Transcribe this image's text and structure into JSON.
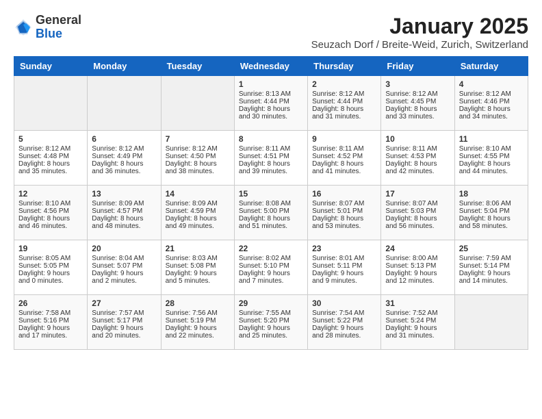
{
  "header": {
    "logo_general": "General",
    "logo_blue": "Blue",
    "title": "January 2025",
    "subtitle": "Seuzach Dorf / Breite-Weid, Zurich, Switzerland"
  },
  "weekdays": [
    "Sunday",
    "Monday",
    "Tuesday",
    "Wednesday",
    "Thursday",
    "Friday",
    "Saturday"
  ],
  "weeks": [
    {
      "days": [
        {
          "num": "",
          "content": ""
        },
        {
          "num": "",
          "content": ""
        },
        {
          "num": "",
          "content": ""
        },
        {
          "num": "1",
          "content": "Sunrise: 8:13 AM\nSunset: 4:44 PM\nDaylight: 8 hours\nand 30 minutes."
        },
        {
          "num": "2",
          "content": "Sunrise: 8:12 AM\nSunset: 4:44 PM\nDaylight: 8 hours\nand 31 minutes."
        },
        {
          "num": "3",
          "content": "Sunrise: 8:12 AM\nSunset: 4:45 PM\nDaylight: 8 hours\nand 33 minutes."
        },
        {
          "num": "4",
          "content": "Sunrise: 8:12 AM\nSunset: 4:46 PM\nDaylight: 8 hours\nand 34 minutes."
        }
      ]
    },
    {
      "days": [
        {
          "num": "5",
          "content": "Sunrise: 8:12 AM\nSunset: 4:48 PM\nDaylight: 8 hours\nand 35 minutes."
        },
        {
          "num": "6",
          "content": "Sunrise: 8:12 AM\nSunset: 4:49 PM\nDaylight: 8 hours\nand 36 minutes."
        },
        {
          "num": "7",
          "content": "Sunrise: 8:12 AM\nSunset: 4:50 PM\nDaylight: 8 hours\nand 38 minutes."
        },
        {
          "num": "8",
          "content": "Sunrise: 8:11 AM\nSunset: 4:51 PM\nDaylight: 8 hours\nand 39 minutes."
        },
        {
          "num": "9",
          "content": "Sunrise: 8:11 AM\nSunset: 4:52 PM\nDaylight: 8 hours\nand 41 minutes."
        },
        {
          "num": "10",
          "content": "Sunrise: 8:11 AM\nSunset: 4:53 PM\nDaylight: 8 hours\nand 42 minutes."
        },
        {
          "num": "11",
          "content": "Sunrise: 8:10 AM\nSunset: 4:55 PM\nDaylight: 8 hours\nand 44 minutes."
        }
      ]
    },
    {
      "days": [
        {
          "num": "12",
          "content": "Sunrise: 8:10 AM\nSunset: 4:56 PM\nDaylight: 8 hours\nand 46 minutes."
        },
        {
          "num": "13",
          "content": "Sunrise: 8:09 AM\nSunset: 4:57 PM\nDaylight: 8 hours\nand 48 minutes."
        },
        {
          "num": "14",
          "content": "Sunrise: 8:09 AM\nSunset: 4:59 PM\nDaylight: 8 hours\nand 49 minutes."
        },
        {
          "num": "15",
          "content": "Sunrise: 8:08 AM\nSunset: 5:00 PM\nDaylight: 8 hours\nand 51 minutes."
        },
        {
          "num": "16",
          "content": "Sunrise: 8:07 AM\nSunset: 5:01 PM\nDaylight: 8 hours\nand 53 minutes."
        },
        {
          "num": "17",
          "content": "Sunrise: 8:07 AM\nSunset: 5:03 PM\nDaylight: 8 hours\nand 56 minutes."
        },
        {
          "num": "18",
          "content": "Sunrise: 8:06 AM\nSunset: 5:04 PM\nDaylight: 8 hours\nand 58 minutes."
        }
      ]
    },
    {
      "days": [
        {
          "num": "19",
          "content": "Sunrise: 8:05 AM\nSunset: 5:05 PM\nDaylight: 9 hours\nand 0 minutes."
        },
        {
          "num": "20",
          "content": "Sunrise: 8:04 AM\nSunset: 5:07 PM\nDaylight: 9 hours\nand 2 minutes."
        },
        {
          "num": "21",
          "content": "Sunrise: 8:03 AM\nSunset: 5:08 PM\nDaylight: 9 hours\nand 5 minutes."
        },
        {
          "num": "22",
          "content": "Sunrise: 8:02 AM\nSunset: 5:10 PM\nDaylight: 9 hours\nand 7 minutes."
        },
        {
          "num": "23",
          "content": "Sunrise: 8:01 AM\nSunset: 5:11 PM\nDaylight: 9 hours\nand 9 minutes."
        },
        {
          "num": "24",
          "content": "Sunrise: 8:00 AM\nSunset: 5:13 PM\nDaylight: 9 hours\nand 12 minutes."
        },
        {
          "num": "25",
          "content": "Sunrise: 7:59 AM\nSunset: 5:14 PM\nDaylight: 9 hours\nand 14 minutes."
        }
      ]
    },
    {
      "days": [
        {
          "num": "26",
          "content": "Sunrise: 7:58 AM\nSunset: 5:16 PM\nDaylight: 9 hours\nand 17 minutes."
        },
        {
          "num": "27",
          "content": "Sunrise: 7:57 AM\nSunset: 5:17 PM\nDaylight: 9 hours\nand 20 minutes."
        },
        {
          "num": "28",
          "content": "Sunrise: 7:56 AM\nSunset: 5:19 PM\nDaylight: 9 hours\nand 22 minutes."
        },
        {
          "num": "29",
          "content": "Sunrise: 7:55 AM\nSunset: 5:20 PM\nDaylight: 9 hours\nand 25 minutes."
        },
        {
          "num": "30",
          "content": "Sunrise: 7:54 AM\nSunset: 5:22 PM\nDaylight: 9 hours\nand 28 minutes."
        },
        {
          "num": "31",
          "content": "Sunrise: 7:52 AM\nSunset: 5:24 PM\nDaylight: 9 hours\nand 31 minutes."
        },
        {
          "num": "",
          "content": ""
        }
      ]
    }
  ]
}
